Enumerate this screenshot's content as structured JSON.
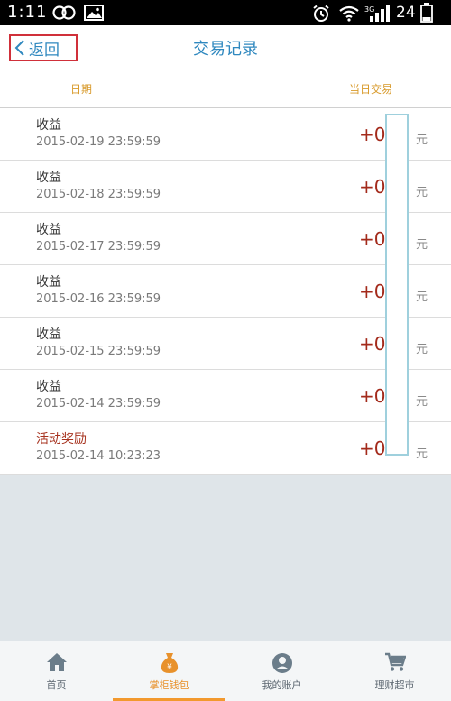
{
  "status_bar": {
    "time": "1:11",
    "battery": "24",
    "network": "3G"
  },
  "header": {
    "back_label": "返回",
    "title": "交易记录"
  },
  "columns": {
    "date": "日期",
    "amount": "当日交易"
  },
  "transactions": [
    {
      "type": "收益",
      "datetime": "2015-02-19 23:59:59",
      "amount": "+0.",
      "unit": "元"
    },
    {
      "type": "收益",
      "datetime": "2015-02-18 23:59:59",
      "amount": "+0.",
      "unit": "元"
    },
    {
      "type": "收益",
      "datetime": "2015-02-17 23:59:59",
      "amount": "+0.",
      "unit": "元"
    },
    {
      "type": "收益",
      "datetime": "2015-02-16 23:59:59",
      "amount": "+0.",
      "unit": "元"
    },
    {
      "type": "收益",
      "datetime": "2015-02-15 23:59:59",
      "amount": "+0.",
      "unit": "元"
    },
    {
      "type": "收益",
      "datetime": "2015-02-14 23:59:59",
      "amount": "+0.",
      "unit": "元"
    },
    {
      "type": "活动奖励",
      "datetime": "2015-02-14 10:23:23",
      "amount": "+0.",
      "unit": "元"
    }
  ],
  "bottom_nav": [
    {
      "label": "首页",
      "icon": "home-icon"
    },
    {
      "label": "掌柜钱包",
      "icon": "money-bag-icon",
      "active": true
    },
    {
      "label": "我的账户",
      "icon": "account-icon"
    },
    {
      "label": "理财超市",
      "icon": "cart-icon"
    }
  ],
  "colors": {
    "accent_blue": "#2f88bf",
    "amount_red": "#a32a1b",
    "orange": "#e8912b",
    "nav_icon": "#6b7d8a"
  }
}
